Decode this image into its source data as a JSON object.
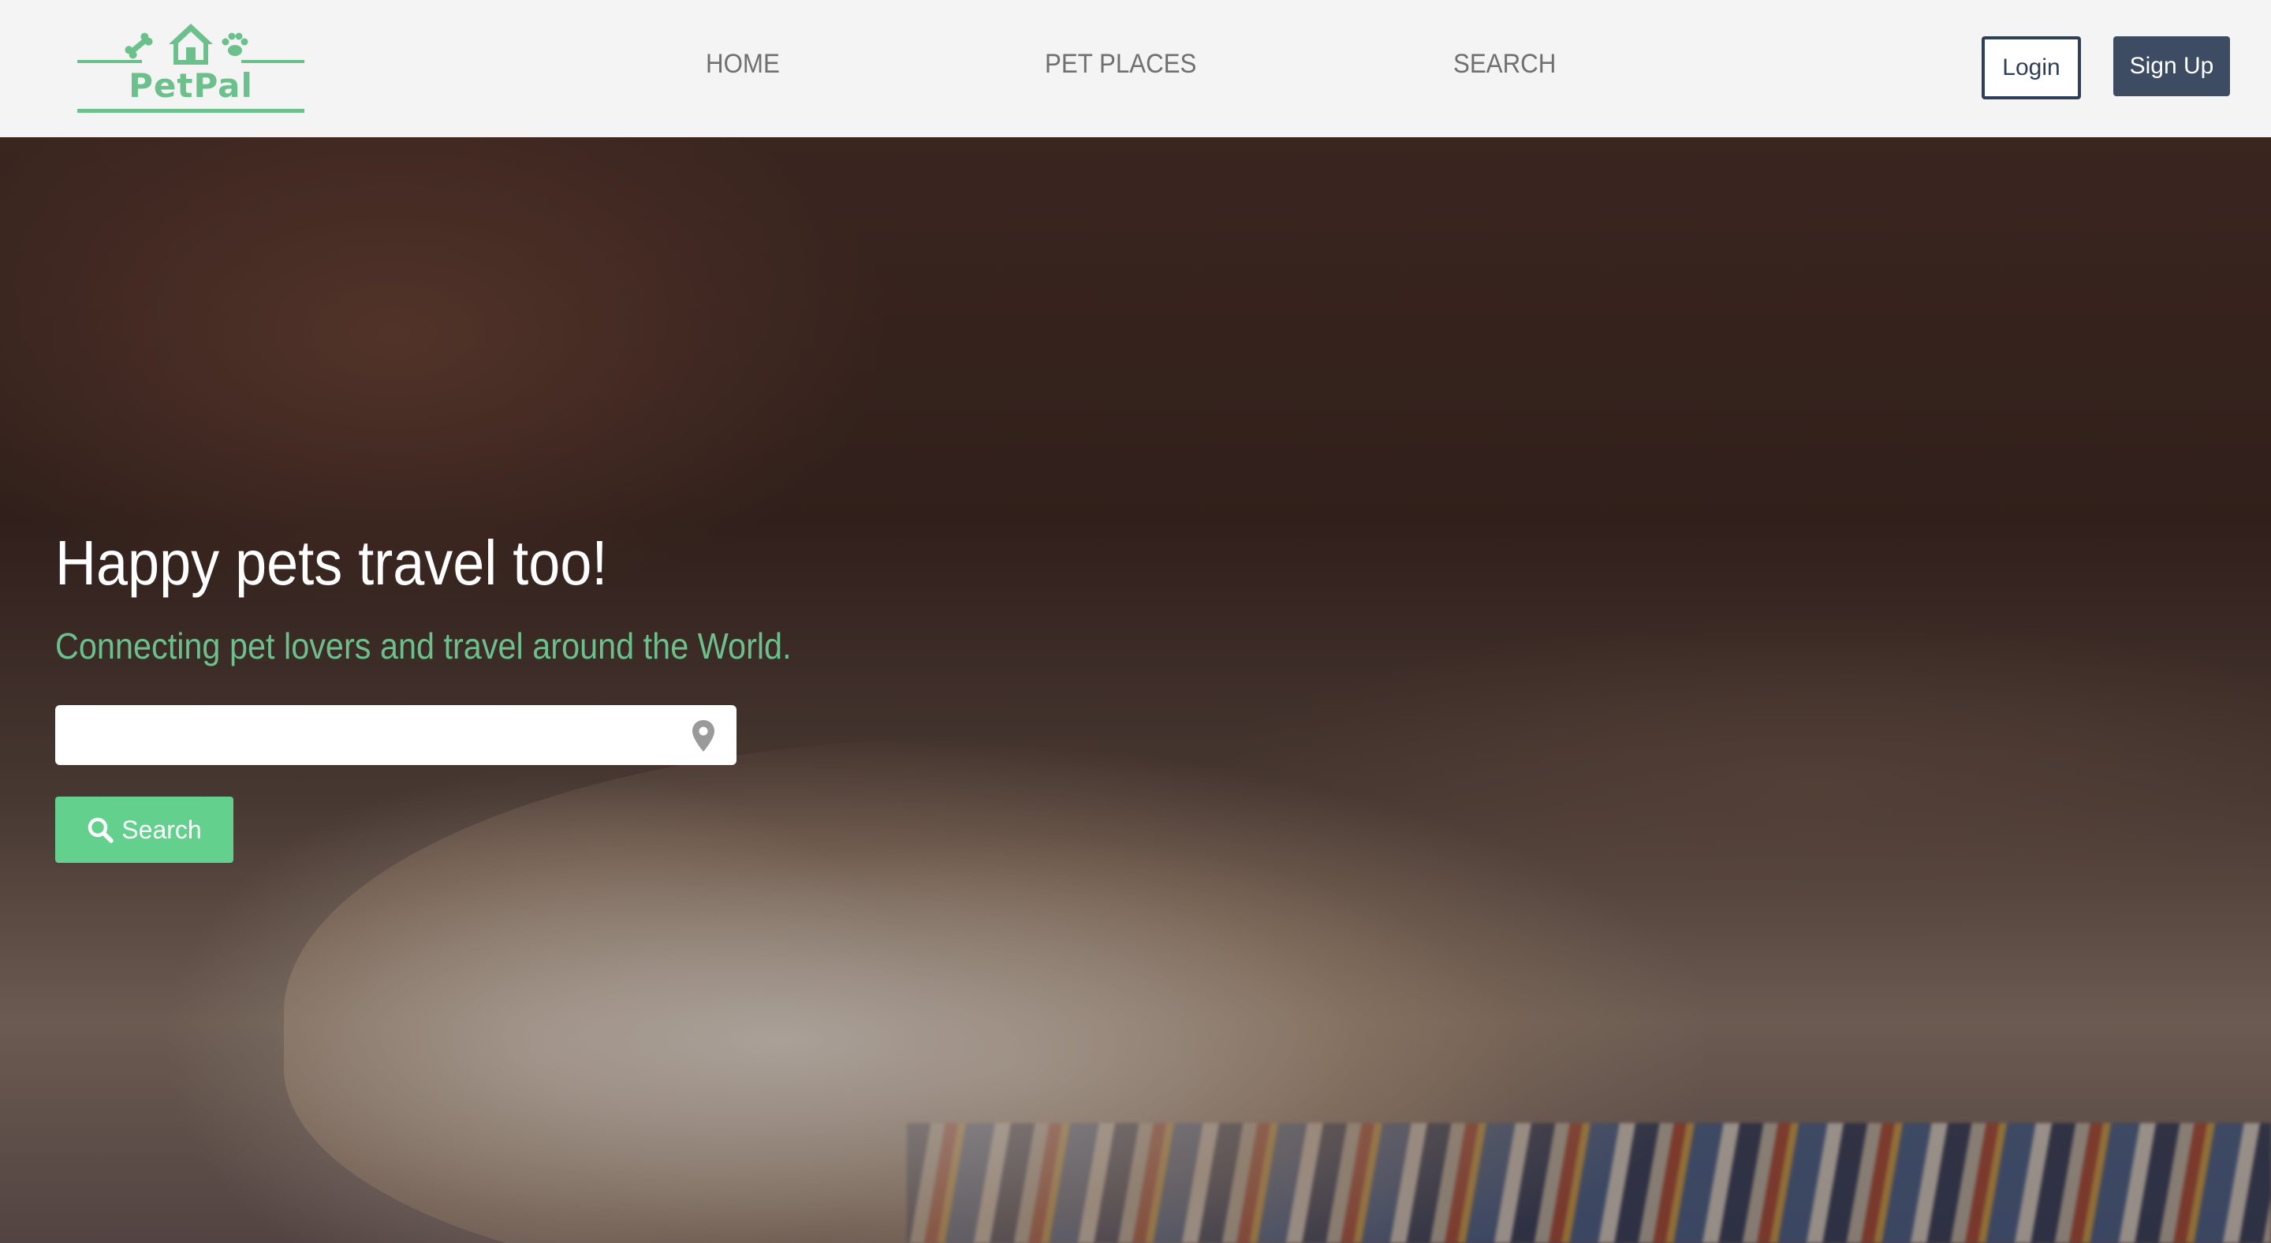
{
  "brand": {
    "name": "PetPal",
    "color": "#6cc08b"
  },
  "nav": {
    "home": "HOME",
    "pet_places": "PET PLACES",
    "search": "SEARCH"
  },
  "auth": {
    "login": "Login",
    "signup": "Sign Up"
  },
  "hero": {
    "title": "Happy pets travel too!",
    "subtitle": "Connecting pet lovers and travel around the World.",
    "search_input": {
      "value": "",
      "placeholder": ""
    },
    "search_button": "Search"
  },
  "icons": {
    "logo": [
      "bone-icon",
      "house-icon",
      "paw-icon"
    ],
    "location": "map-pin-icon",
    "search": "search-icon"
  },
  "colors": {
    "accent_green": "#63d18d",
    "navy": "#3d4b63",
    "nav_text": "#707070"
  }
}
